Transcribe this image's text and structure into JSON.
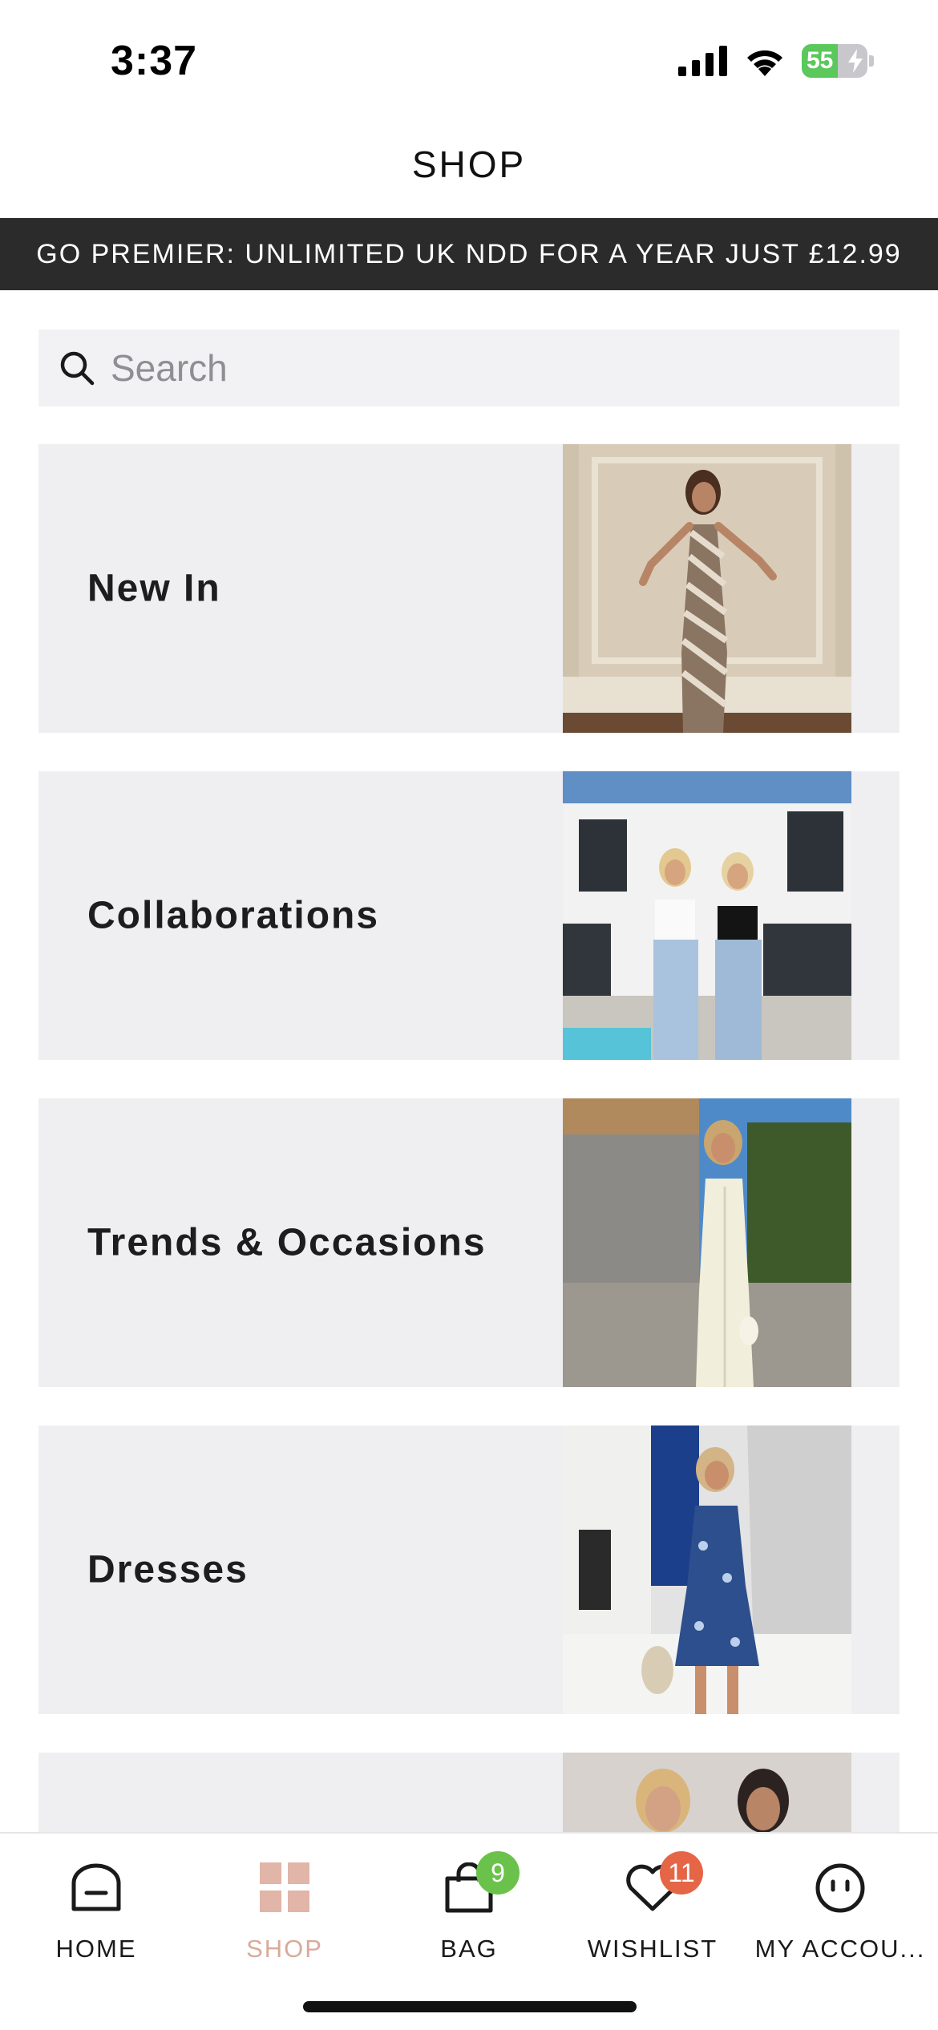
{
  "status_bar": {
    "time": "3:37",
    "battery_percent": 55,
    "battery_label": "55"
  },
  "header": {
    "title": "SHOP"
  },
  "promo": {
    "text": "GO PREMIER: UNLIMITED UK NDD FOR A YEAR JUST £12.99"
  },
  "search": {
    "placeholder": "Search",
    "value": ""
  },
  "categories": [
    {
      "label": "New In"
    },
    {
      "label": "Collaborations"
    },
    {
      "label": "Trends & Occasions"
    },
    {
      "label": "Dresses"
    },
    {
      "label": ""
    }
  ],
  "tab_bar": {
    "active": "SHOP",
    "active_color": "#d9aa9a",
    "tabs": [
      {
        "label": "HOME",
        "icon": "home-icon"
      },
      {
        "label": "SHOP",
        "icon": "grid-icon"
      },
      {
        "label": "BAG",
        "icon": "bag-icon",
        "badge": "9",
        "badge_color": "#6bc24a"
      },
      {
        "label": "WISHLIST",
        "icon": "heart-icon",
        "badge": "11",
        "badge_color": "#e56547"
      },
      {
        "label": "MY ACCOU...",
        "icon": "account-icon"
      }
    ]
  }
}
